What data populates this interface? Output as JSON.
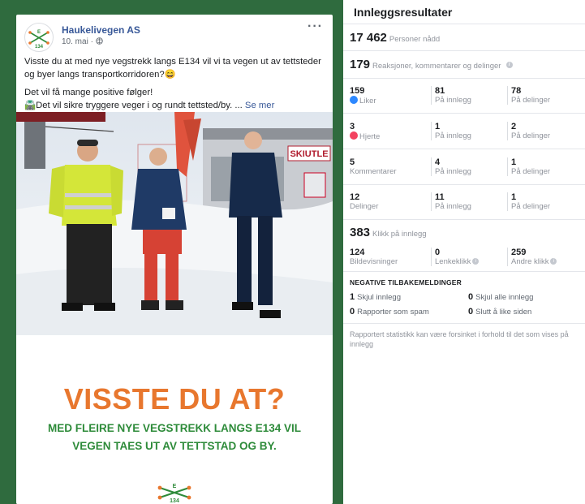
{
  "post": {
    "page_name": "Haukelivegen AS",
    "date": "10. mai",
    "more_label": "···",
    "text_line1": "Visste du at med nye vegstrekk langs E134 vil vi ta vegen ut av tettsteder og byer langs transportkorridoren?😄",
    "text_line2": "Det vil få mange positive følger!",
    "text_line3": "🛣️Det vil sikre tryggere veger i og rundt tettsted/by. ...",
    "see_more": "Se mer",
    "photo_sign": "SKIUTLE",
    "banner_title": "VISSTE DU AT?",
    "banner_sub_line1": "MED FLEIRE NYE VEGSTREKK LANGS E134 VIL",
    "banner_sub_line2": "VEGEN TAES UT AV TETTSTAD OG BY.",
    "logo_top": "E",
    "logo_bottom": "134"
  },
  "insights": {
    "title": "Innleggsresultater",
    "reach": {
      "value": "17 462",
      "label": "Personer nådd"
    },
    "engagement": {
      "value": "179",
      "label": "Reaksjoner, kommentarer og delinger"
    },
    "rows": [
      {
        "icon": "like-icon",
        "total": "159",
        "label": "Liker",
        "on_post": "81",
        "on_post_label": "På innlegg",
        "on_shares": "78",
        "on_shares_label": "På delinger"
      },
      {
        "icon": "heart-icon",
        "total": "3",
        "label": "Hjerte",
        "on_post": "1",
        "on_post_label": "På innlegg",
        "on_shares": "2",
        "on_shares_label": "På delinger"
      },
      {
        "icon": "",
        "total": "5",
        "label": "Kommentarer",
        "on_post": "4",
        "on_post_label": "På innlegg",
        "on_shares": "1",
        "on_shares_label": "På delinger"
      },
      {
        "icon": "",
        "total": "12",
        "label": "Delinger",
        "on_post": "11",
        "on_post_label": "På innlegg",
        "on_shares": "1",
        "on_shares_label": "På delinger"
      }
    ],
    "clicks": {
      "value": "383",
      "label": "Klikk på innlegg"
    },
    "click_breakdown": [
      {
        "value": "124",
        "label": "Bildevisninger"
      },
      {
        "value": "0",
        "label": "Lenkeklikk"
      },
      {
        "value": "259",
        "label": "Andre klikk"
      }
    ],
    "negative": {
      "title": "NEGATIVE TILBAKEMELDINGER",
      "items": [
        {
          "value": "1",
          "label": "Skjul innlegg"
        },
        {
          "value": "0",
          "label": "Skjul alle innlegg"
        },
        {
          "value": "0",
          "label": "Rapporter som spam"
        },
        {
          "value": "0",
          "label": "Slutt å like siden"
        }
      ]
    },
    "footnote": "Rapportert statistikk kan være forsinket i forhold til det som vises på innlegg"
  }
}
